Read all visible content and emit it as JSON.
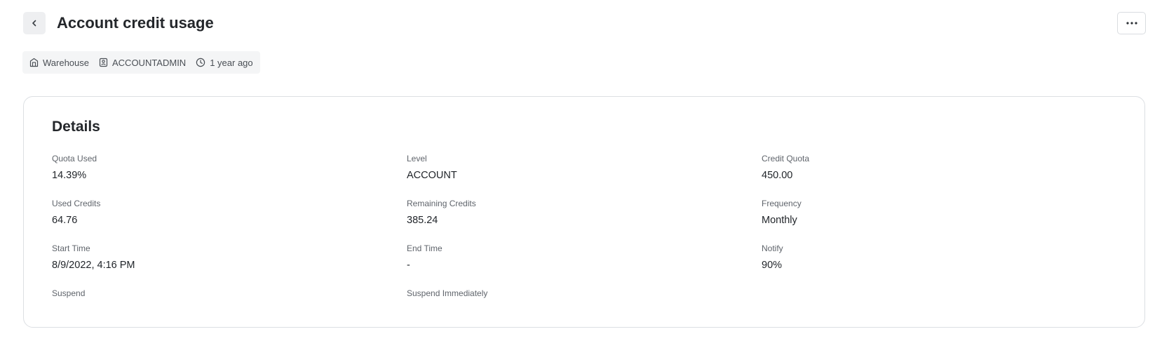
{
  "header": {
    "title": "Account credit usage",
    "back_icon": "chevron-left-icon",
    "more_icon": "ellipsis-icon"
  },
  "meta": {
    "type_label": "Warehouse",
    "owner_label": "ACCOUNTADMIN",
    "time_label": "1 year ago"
  },
  "details": {
    "title": "Details",
    "fields": [
      {
        "label": "Quota Used",
        "value": "14.39%"
      },
      {
        "label": "Level",
        "value": "ACCOUNT"
      },
      {
        "label": "Credit Quota",
        "value": "450.00"
      },
      {
        "label": "Used Credits",
        "value": "64.76"
      },
      {
        "label": "Remaining Credits",
        "value": "385.24"
      },
      {
        "label": "Frequency",
        "value": "Monthly"
      },
      {
        "label": "Start Time",
        "value": "8/9/2022, 4:16 PM"
      },
      {
        "label": "End Time",
        "value": "-"
      },
      {
        "label": "Notify",
        "value": "90%"
      },
      {
        "label": "Suspend",
        "value": ""
      },
      {
        "label": "Suspend Immediately",
        "value": ""
      }
    ]
  },
  "colors": {
    "title": "#24272b",
    "label": "#5f646b",
    "border": "#dcdfe3",
    "chip_bg": "#f4f5f6"
  }
}
